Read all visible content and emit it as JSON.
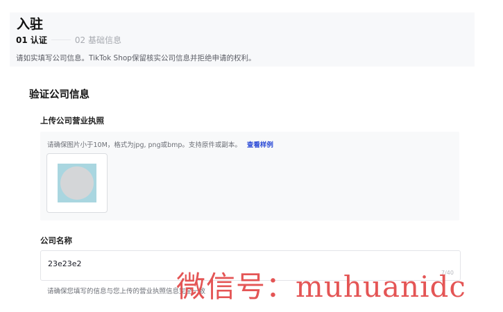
{
  "page": {
    "title": "入驻",
    "steps": [
      {
        "label": "01 认证",
        "active": true
      },
      {
        "label": "02 基础信息",
        "active": false
      }
    ],
    "intro": "请如实填写公司信息。TikTok Shop保留核实公司信息并拒绝申请的权利。"
  },
  "verify_section": {
    "title": "验证公司信息",
    "upload": {
      "label": "上传公司营业执照",
      "hint": "请确保图片小于10M，格式为jpg, png或bmp。支持原件或副本。",
      "sample_link": "查看样例"
    },
    "company_name": {
      "label": "公司名称",
      "value": "23e23e2",
      "counter": "7/40",
      "hint": "请确保您填写的信息与您上传的营业执照信息完全一致"
    }
  },
  "watermark": "微信号：muhuanidc",
  "colors": {
    "link": "#2b4bd6",
    "watermark": "#e24646"
  }
}
